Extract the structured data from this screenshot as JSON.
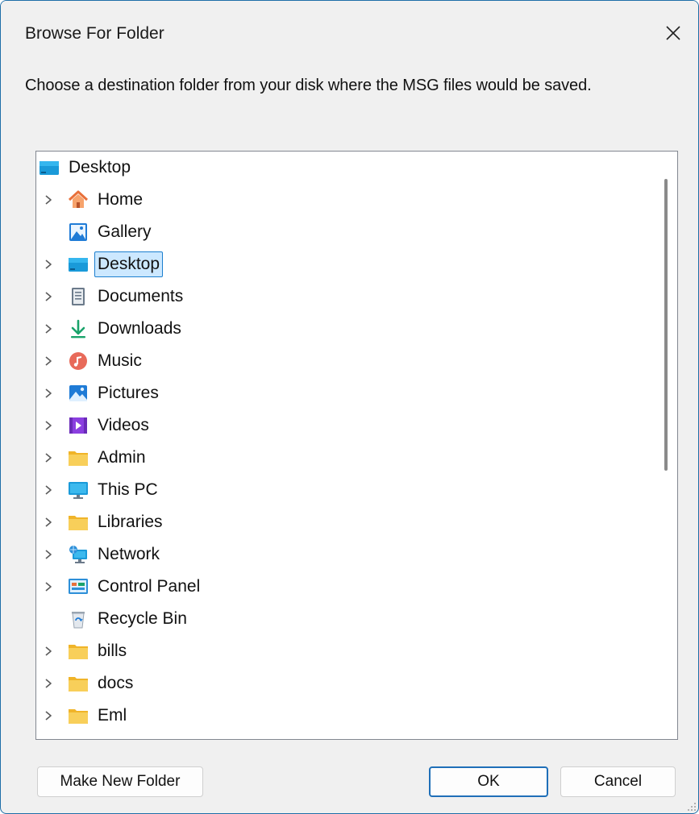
{
  "window": {
    "title": "Browse For Folder",
    "close_icon": "close-icon"
  },
  "prompt": "Choose a destination folder from your disk where the MSG files would be saved.",
  "tree": {
    "items": [
      {
        "label": "Desktop",
        "icon": "desktop-icon",
        "expandable": false,
        "selected": false
      },
      {
        "label": "Home",
        "icon": "home-icon",
        "expandable": true,
        "selected": false
      },
      {
        "label": "Gallery",
        "icon": "gallery-icon",
        "expandable": false,
        "selected": false
      },
      {
        "label": "Desktop",
        "icon": "desktop-icon",
        "expandable": true,
        "selected": true
      },
      {
        "label": "Documents",
        "icon": "documents-icon",
        "expandable": true,
        "selected": false
      },
      {
        "label": "Downloads",
        "icon": "downloads-icon",
        "expandable": true,
        "selected": false
      },
      {
        "label": "Music",
        "icon": "music-icon",
        "expandable": true,
        "selected": false
      },
      {
        "label": "Pictures",
        "icon": "pictures-icon",
        "expandable": true,
        "selected": false
      },
      {
        "label": "Videos",
        "icon": "videos-icon",
        "expandable": true,
        "selected": false
      },
      {
        "label": "Admin",
        "icon": "folder-icon",
        "expandable": true,
        "selected": false
      },
      {
        "label": "This PC",
        "icon": "this-pc-icon",
        "expandable": true,
        "selected": false
      },
      {
        "label": "Libraries",
        "icon": "folder-icon",
        "expandable": true,
        "selected": false
      },
      {
        "label": "Network",
        "icon": "network-icon",
        "expandable": true,
        "selected": false
      },
      {
        "label": "Control Panel",
        "icon": "control-panel-icon",
        "expandable": true,
        "selected": false
      },
      {
        "label": "Recycle Bin",
        "icon": "recycle-bin-icon",
        "expandable": false,
        "selected": false
      },
      {
        "label": "bills",
        "icon": "folder-icon",
        "expandable": true,
        "selected": false
      },
      {
        "label": "docs",
        "icon": "folder-icon",
        "expandable": true,
        "selected": false
      },
      {
        "label": "Eml",
        "icon": "folder-icon",
        "expandable": true,
        "selected": false
      }
    ]
  },
  "buttons": {
    "make_new_folder": "Make New Folder",
    "ok": "OK",
    "cancel": "Cancel"
  },
  "colors": {
    "accent": "#1f6fb8",
    "selection_bg": "#cce8ff",
    "selection_border": "#1c7fcf",
    "folder": "#f6c344"
  }
}
